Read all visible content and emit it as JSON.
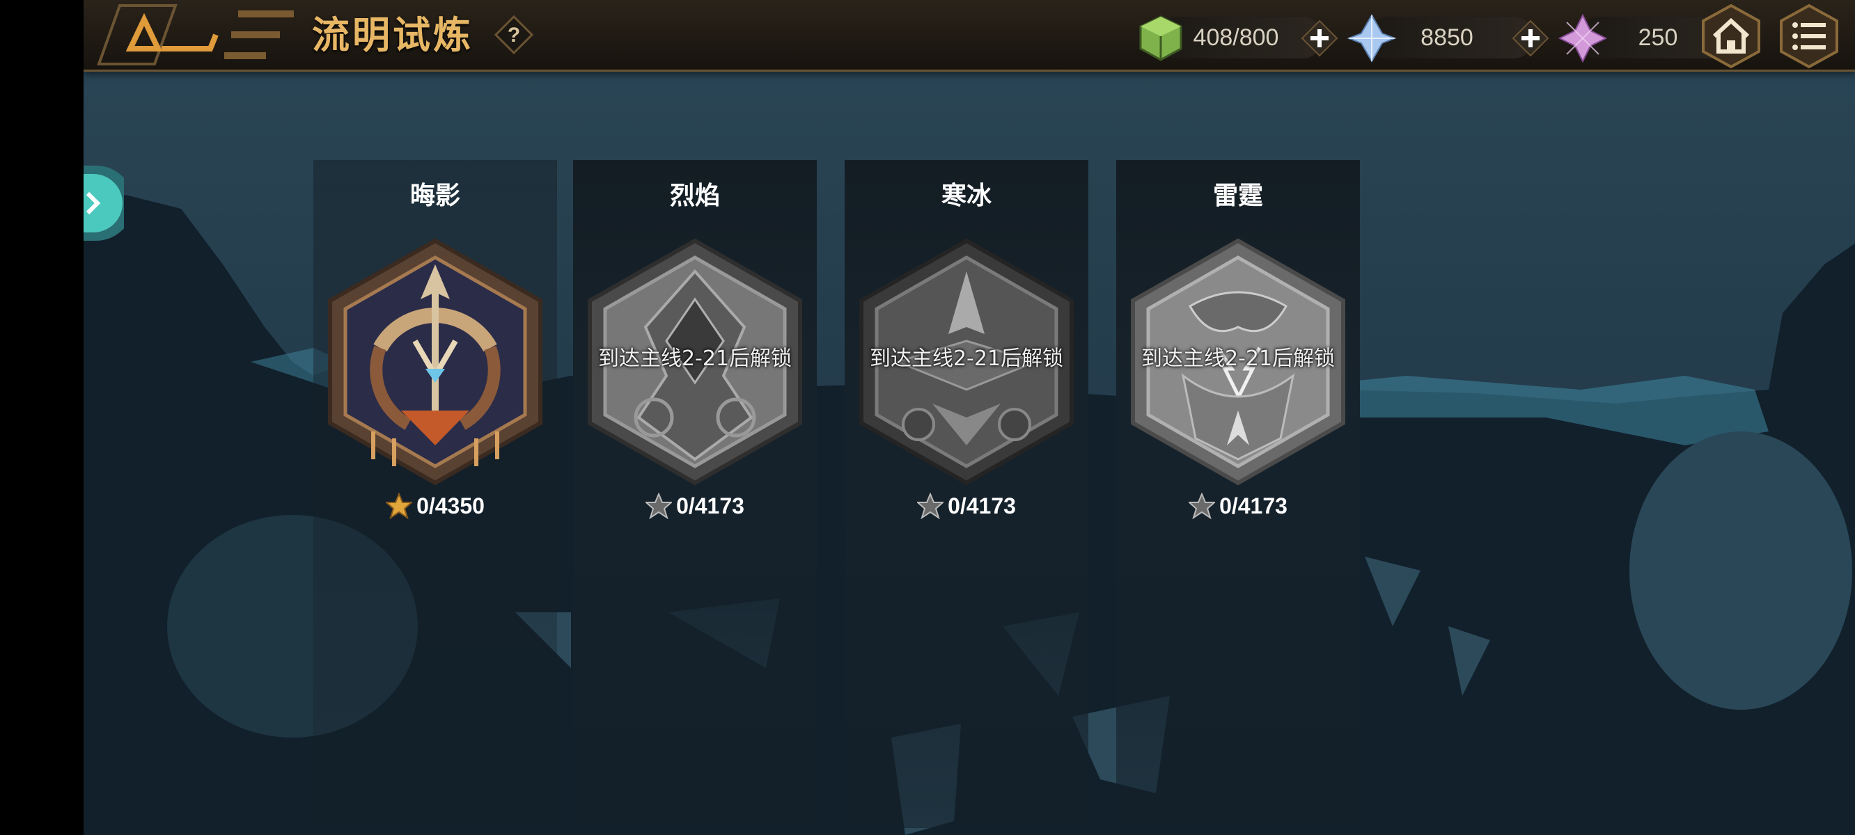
{
  "header": {
    "title": "流明试炼",
    "help_icon": "question-icon",
    "resources": [
      {
        "icon": "stamina-cube-icon",
        "value": "408/800"
      },
      {
        "icon": "blue-crystal-icon",
        "value": "8850"
      },
      {
        "icon": "pink-crystal-icon",
        "value": "250"
      }
    ],
    "home_icon": "home-icon",
    "menu_icon": "list-menu-icon"
  },
  "trials": [
    {
      "name": "晦影",
      "lock_text": "",
      "score": "0/4350",
      "locked": false
    },
    {
      "name": "烈焰",
      "lock_text": "到达主线2-21后解锁",
      "score": "0/4173",
      "locked": true
    },
    {
      "name": "寒冰",
      "lock_text": "到达主线2-21后解锁",
      "score": "0/4173",
      "locked": true
    },
    {
      "name": "雷霆",
      "lock_text": "到达主线2-21后解锁",
      "score": "0/4173",
      "locked": true
    }
  ],
  "colors": {
    "accent": "#e7b765",
    "teal": "#4cc9bf",
    "star_gold": "#e0a63c"
  }
}
